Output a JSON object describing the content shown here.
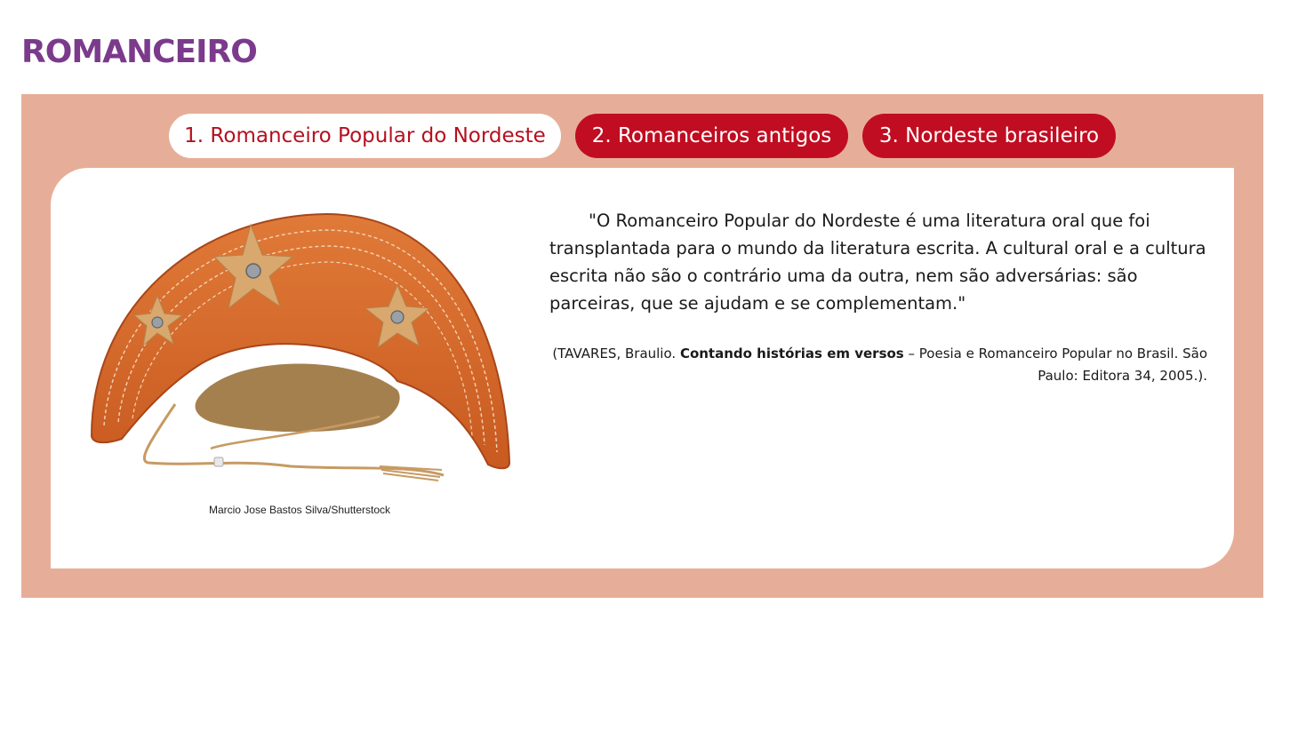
{
  "page": {
    "title": "ROMANCEIRO"
  },
  "tabs": [
    {
      "label": "1. Romanceiro Popular do Nordeste",
      "active": true
    },
    {
      "label": "2. Romanceiros antigos",
      "active": false
    },
    {
      "label": "3. Nordeste brasileiro",
      "active": false
    }
  ],
  "figure": {
    "image": "leather-hat-with-stars",
    "credit": "Marcio Jose Bastos Silva/Shutterstock"
  },
  "quote": {
    "text": "\"O Romanceiro Popular do Nordeste é uma literatura oral que foi transplantada para o mundo da literatura escrita. A cultural oral e a cultura escrita não são o contrário uma da outra, nem são adversárias: são parceiras, que se ajudam e se complementam.\""
  },
  "citation": {
    "prefix": "(TAVARES, Braulio. ",
    "book": "Contando histórias em versos",
    "suffix": " – Poesia e Romanceiro Popular no Brasil. São Paulo: Editora 34, 2005.)."
  },
  "colors": {
    "title": "#7b3a8c",
    "panel": "#e6ae98",
    "tab_active_text": "#b5101f",
    "tab_inactive_bg": "#c10d21",
    "hat_leather": "#d9692c",
    "hat_stars": "#d8a86e"
  }
}
